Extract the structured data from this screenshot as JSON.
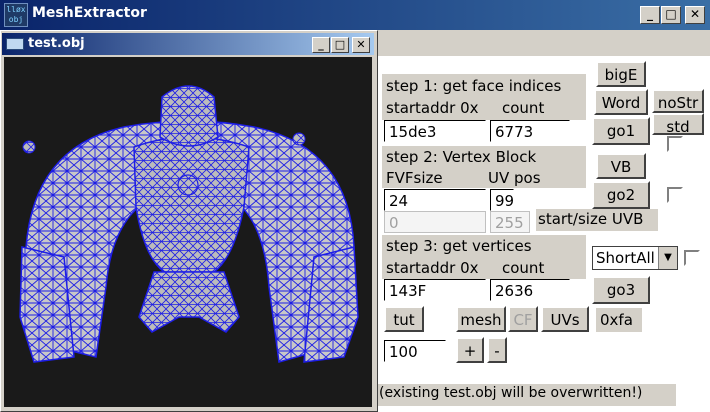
{
  "app": {
    "title": "MeshExtractor",
    "icon_text": "lløx obj"
  },
  "child": {
    "title": "test.obj"
  },
  "step1": {
    "heading": "step 1: get face indices",
    "addr_label": "startaddr 0x",
    "count_label": "count",
    "addr_value": "15de3",
    "count_value": "6773",
    "go_label": "go1"
  },
  "step2": {
    "heading": "step 2: Vertex Block",
    "fvf_label": "FVFsize",
    "uv_label": "UV pos",
    "fvf_value": "24",
    "uv_value": "99",
    "start_value": "0",
    "size_value": "255",
    "uvb_label": "start/size UVB",
    "go_label": "go2"
  },
  "step3": {
    "heading": "step 3: get vertices",
    "addr_label": "startaddr 0x",
    "count_label": "count",
    "addr_value": "143F",
    "count_value": "2636",
    "go_label": "go3",
    "select_value": "ShortAll"
  },
  "buttons": {
    "bigE": "bigE",
    "word": "Word",
    "nostr": "noStr",
    "std": "std",
    "vb": "VB",
    "tut": "tut",
    "mesh": "mesh",
    "cf": "CF",
    "uvs": "UVs",
    "plus": "+",
    "minus": "-"
  },
  "hex_label": "0xfa",
  "scale_value": "100",
  "footer": "(existing test.obj will be overwritten!)",
  "colors": {
    "mesh_fill": "#c8c8c8",
    "wire": "#1e1ee6",
    "viewport_bg": "#1a1a1a"
  }
}
